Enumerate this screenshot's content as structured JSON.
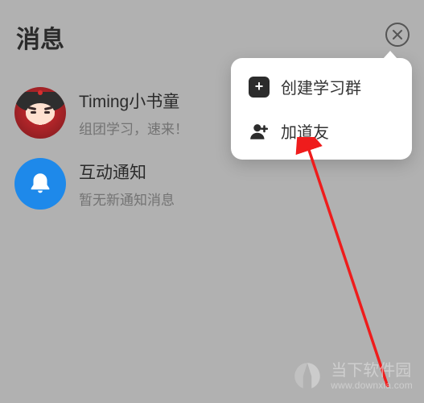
{
  "header": {
    "title": "消息"
  },
  "list": {
    "items": [
      {
        "title": "Timing小书童",
        "subtitle": "组团学习，速来！"
      },
      {
        "title": "互动通知",
        "subtitle": "暂无新通知消息"
      }
    ]
  },
  "popover": {
    "items": [
      {
        "label": "创建学习群"
      },
      {
        "label": "加道友"
      }
    ]
  },
  "watermark": {
    "title": "当下软件园",
    "url": "www.downxia.com"
  }
}
